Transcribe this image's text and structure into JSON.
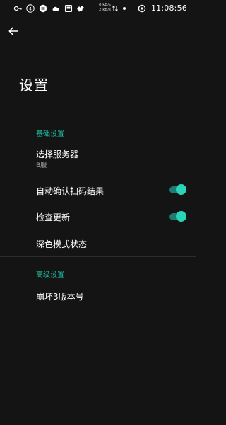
{
  "status_bar": {
    "time": "11:08:56",
    "net_up": "0 kB/s",
    "net_down": "2 kB/s",
    "notification_icons": [
      "vpn-key-icon",
      "sim-badge-icon",
      "notes-icon",
      "cloud-icon",
      "tablet-icon",
      "bird-icon"
    ]
  },
  "header": {
    "title": "设置"
  },
  "sections": {
    "basic": {
      "label": "基础设置",
      "server": {
        "title": "选择服务器",
        "value": "B服"
      },
      "auto_confirm": {
        "title": "自动确认扫码结果",
        "enabled": true
      },
      "check_update": {
        "title": "检查更新",
        "enabled": true
      },
      "dark_mode": {
        "title": "深色模式状态"
      }
    },
    "advanced": {
      "label": "高级设置",
      "version": {
        "title": "崩坏3版本号"
      }
    }
  },
  "colors": {
    "background": "#141414",
    "accent": "#1fbfa8",
    "switch_track": "#1d7d70",
    "switch_thumb": "#2bd4b8",
    "subtitle": "#a8a8a8"
  }
}
